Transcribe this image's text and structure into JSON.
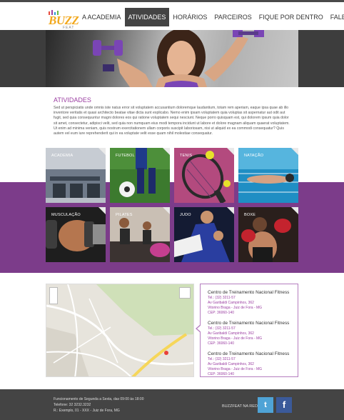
{
  "header": {
    "logo_text": "BUZZ",
    "logo_sub": "FEAT",
    "nav": [
      {
        "label": "A ACADEMIA",
        "active": false
      },
      {
        "label": "ATIVIDADES",
        "active": true
      },
      {
        "label": "HORÁRIOS",
        "active": false
      },
      {
        "label": "PARCEIROS",
        "active": false
      },
      {
        "label": "FIQUE POR DENTRO",
        "active": false
      },
      {
        "label": "FALE CONOSCO",
        "active": false
      }
    ]
  },
  "main": {
    "title": "ATIVIDADES",
    "text": "Sed ut perspiciatis unde omnis iste natus error sit voluptatem accusantium doloremque laudantium, totam rem aperiam, eaque ipsa quae ab illo inventore veritatis et quasi architecto beatae vitae dicta sunt explicabo. Nemo enim ipsam voluptatem quia voluptas sit aspernatur aut odit aut fugit, sed quia consequuntur magni dolores eos qui ratione voluptatem sequi nesciunt. Neque porro quisquam est, qui dolorem ipsum quia dolor sit amet, consectetur, adipisci velit, sed quia non numquam eius modi tempora incidunt ut labore et dolore magnam aliquam quaerat voluptatem. Ut enim ad minima veniam, quis nostrum exercitationem ullam corporis suscipit laboriosam, nisi ut aliquid ex ea commodi consequatur? Quis autem vel eum iure reprehenderit qui in ea voluptate velit esse quam nihil molestiae consequatur."
  },
  "activities": [
    {
      "label": "ACADEMIA"
    },
    {
      "label": "FUTEBOL"
    },
    {
      "label": "TENIS"
    },
    {
      "label": "NATAÇÃO"
    },
    {
      "label": "MUSCULAÇÃO"
    },
    {
      "label": "PILATES"
    },
    {
      "label": "JUDO"
    },
    {
      "label": "BOXE"
    }
  ],
  "contacts": [
    {
      "name": "Centro de Treinamento Nacional Fitness",
      "phone": "Tel.: (32) 3211-57",
      "street": "Av Garibaldi Campinhos, 362",
      "city": "Vitorino Braga - Juiz de Fora - MG",
      "cep": "CEP: 36060-140"
    },
    {
      "name": "Centro de Treinamento Nacional Fitness",
      "phone": "Tel.: (32) 3211-57",
      "street": "Av Garibaldi Campinhos, 362",
      "city": "Vitorino Braga - Juiz de Fora - MG",
      "cep": "CEP: 36060-140"
    },
    {
      "name": "Centro de Treinamento Nacional Fitness",
      "phone": "Tel.: (32) 3211-57",
      "street": "Av Garibaldi Campinhos, 362",
      "city": "Vitorino Braga - Juiz de Fora - MG",
      "cep": "CEP: 36060-140"
    }
  ],
  "footer": {
    "hours": "Funcionamento de Segunda a Sexta, das 09:00 às 18:00",
    "phone": "Telefone: 32 3232.3232",
    "address": "R.: Exemplo, 01 - XXX - Juiz de Fora, MG",
    "social_label": "BUZZFEAT NA REDE",
    "twitter_glyph": "t",
    "facebook_glyph": "f"
  },
  "colors": {
    "accent": "#7c3c8a",
    "title": "#9b3fa2",
    "logo": "#f2a81d",
    "dark": "#444444"
  }
}
